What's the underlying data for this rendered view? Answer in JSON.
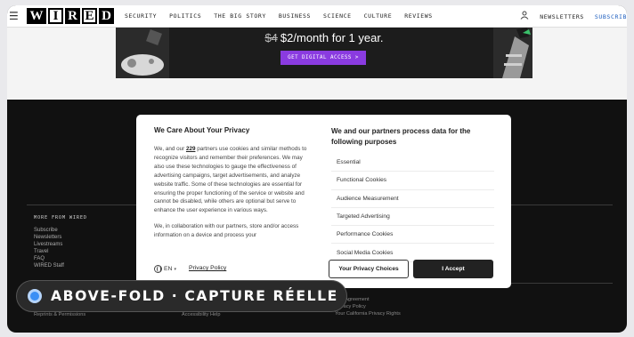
{
  "nav": {
    "menu_icon": "hamburger-icon",
    "logo_letters": [
      "W",
      "I",
      "R",
      "E",
      "D"
    ],
    "links": [
      "SECURITY",
      "POLITICS",
      "THE BIG STORY",
      "BUSINESS",
      "SCIENCE",
      "CULTURE",
      "REVIEWS"
    ],
    "user_icon": "user-icon",
    "newsletters": "NEWSLETTERS",
    "subscribe": "SUBSCRIB"
  },
  "promo": {
    "old_price": "$4",
    "price_text": "$2/month for 1 year.",
    "cta": "GET DIGITAL ACCESS >"
  },
  "footer": {
    "more_heading": "MORE FROM WIRED",
    "more_links": [
      "Subscribe",
      "Newsletters",
      "Livestreams",
      "Travel",
      "FAQ",
      "WIRED Staff"
    ],
    "bottom_left": "Reprints & Permissions",
    "bottom_mid": "Accessibility Help",
    "bottom_right": [
      "Use Agreement",
      "Privacy Policy",
      "Your California Privacy Rights"
    ]
  },
  "cookie": {
    "title": "We Care About Your Privacy",
    "body_before": "We, and our ",
    "partner_count": "229",
    "body_after": " partners use cookies and similar methods to recognize visitors and remember their preferences. We may also use these technologies to gauge the effectiveness of advertising campaigns, target advertisements, and analyze website traffic. Some of these technologies are essential for ensuring the proper functioning of the service or website and cannot be disabled, while others are optional but serve to enhance the user experience in various ways.",
    "body_second": "We, in collaboration with our partners, store and/or access information on a device and process your",
    "right_title": "We and our partners process data for the following purposes",
    "categories": [
      "Essential",
      "Functional Cookies",
      "Audience Measurement",
      "Targeted Advertising",
      "Performance Cookies",
      "Social Media Cookies"
    ],
    "language": "EN",
    "policy_link": "Privacy Policy",
    "choices_button": "Your Privacy Choices",
    "accept_button": "I Accept"
  },
  "badge": {
    "label": "ABOVE-FOLD · CAPTURE RÉELLE"
  },
  "colors": {
    "accent_purple": "#8a3be0",
    "subscribe_blue": "#1f5fbf",
    "badge_dot": "#3b8ff5"
  }
}
